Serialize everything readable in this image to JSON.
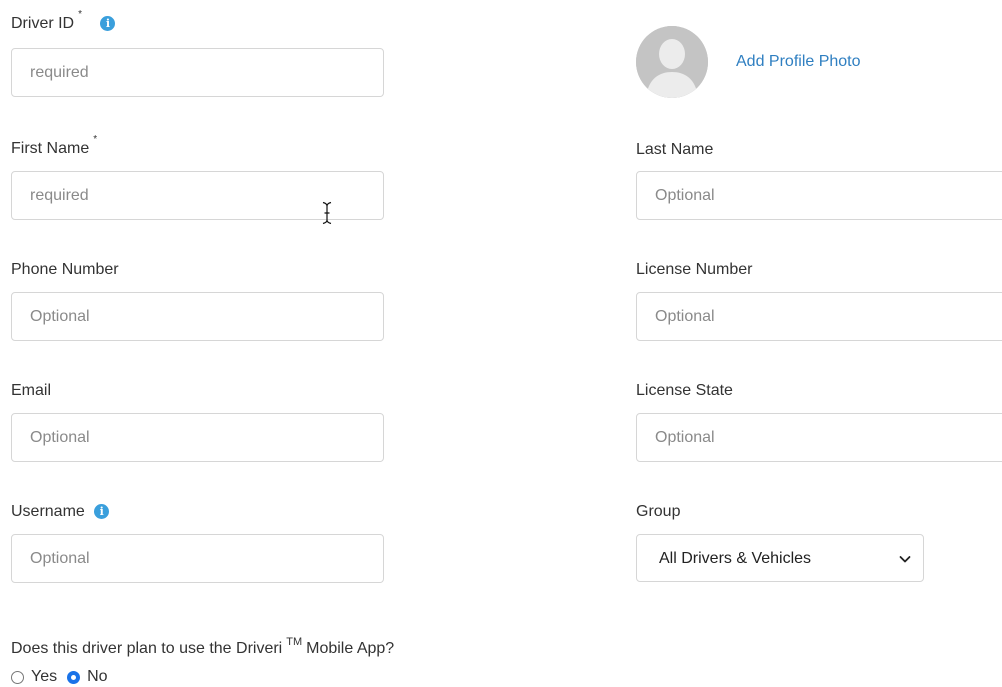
{
  "driver_id": {
    "label": "Driver ID",
    "required_mark": "*",
    "placeholder": "required",
    "value": ""
  },
  "profile_photo": {
    "link_label": "Add Profile Photo"
  },
  "first_name": {
    "label": "First Name",
    "required_mark": "*",
    "placeholder": "required",
    "value": ""
  },
  "last_name": {
    "label": "Last Name",
    "placeholder": "Optional",
    "value": ""
  },
  "phone_number": {
    "label": "Phone Number",
    "placeholder": "Optional",
    "value": ""
  },
  "license_number": {
    "label": "License Number",
    "placeholder": "Optional",
    "value": ""
  },
  "email": {
    "label": "Email",
    "placeholder": "Optional",
    "value": ""
  },
  "license_state": {
    "label": "License State",
    "placeholder": "Optional",
    "value": ""
  },
  "username": {
    "label": "Username",
    "placeholder": "Optional",
    "value": ""
  },
  "group": {
    "label": "Group",
    "selected": "All Drivers & Vehicles"
  },
  "mobile_app": {
    "question_prefix": "Does this driver plan to use the Driveri",
    "trademark": "TM",
    "question_suffix": "Mobile App?",
    "options": [
      {
        "label": "Yes",
        "checked": false
      },
      {
        "label": "No",
        "checked": true
      }
    ]
  },
  "icons": {
    "info": "info-icon",
    "avatar": "person-silhouette",
    "chevron": "chevron-down-icon",
    "cursor": "text-cursor-icon"
  },
  "colors": {
    "link": "#2f7fc1",
    "info_icon": "#3a9fdc",
    "radio_checked": "#1a73e8",
    "input_border": "#d6d6d6"
  }
}
